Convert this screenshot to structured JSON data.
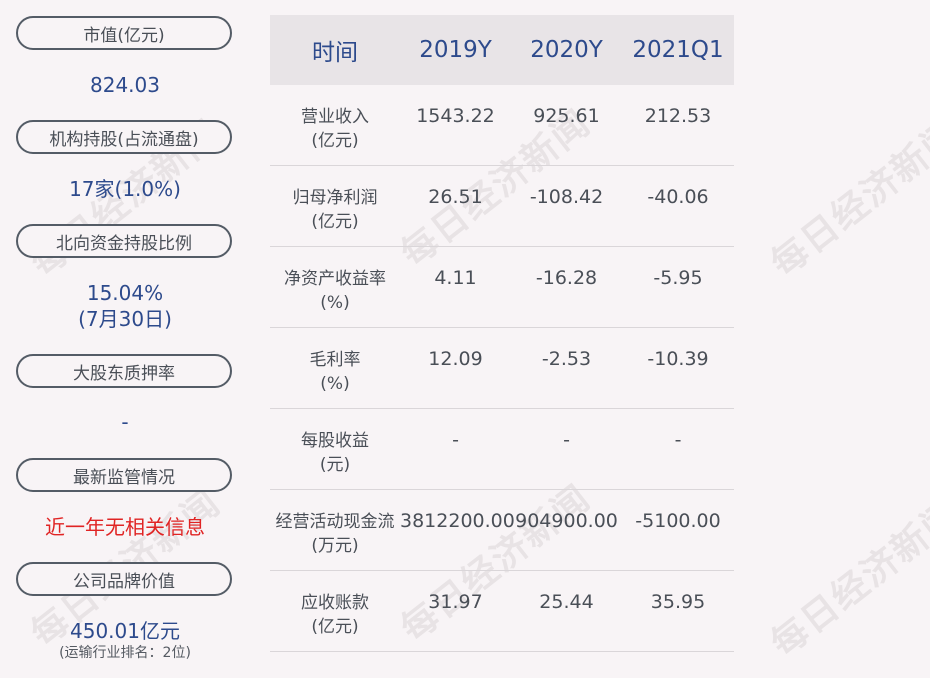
{
  "left_panel": [
    {
      "label": "市值(亿元)",
      "value": "824.03"
    },
    {
      "label": "机构持股(占流通盘)",
      "value": "17家(1.0%)"
    },
    {
      "label": "北向资金持股比例",
      "value": "15.04%",
      "value2": "(7月30日)"
    },
    {
      "label": "大股东质押率",
      "value": "-"
    },
    {
      "label": "最新监管情况",
      "value": "近一年无相关信息"
    },
    {
      "label": "公司品牌价值",
      "value": "450.01亿元",
      "note": "(运输行业排名：2位)"
    }
  ],
  "table": {
    "headers": [
      "时间",
      "2019Y",
      "2020Y",
      "2021Q1"
    ],
    "rows": [
      {
        "label1": "营业收入",
        "label2": "(亿元)",
        "values": [
          "1543.22",
          "925.61",
          "212.53"
        ]
      },
      {
        "label1": "归母净利润",
        "label2": "(亿元)",
        "values": [
          "26.51",
          "-108.42",
          "-40.06"
        ]
      },
      {
        "label1": "净资产收益率",
        "label2": "(%)",
        "values": [
          "4.11",
          "-16.28",
          "-5.95"
        ]
      },
      {
        "label1": "毛利率",
        "label2": "(%)",
        "values": [
          "12.09",
          "-2.53",
          "-10.39"
        ]
      },
      {
        "label1": "每股收益",
        "label2": "(元)",
        "values": [
          "-",
          "-",
          "-"
        ]
      },
      {
        "label1": "经营活动现金流",
        "label2": "(万元)",
        "values": [
          "3812200.00",
          "904900.00",
          "-5100.00"
        ]
      },
      {
        "label1": "应收账款",
        "label2": "(亿元)",
        "values": [
          "31.97",
          "25.44",
          "35.95"
        ]
      }
    ]
  },
  "watermark": "每日经济新闻"
}
